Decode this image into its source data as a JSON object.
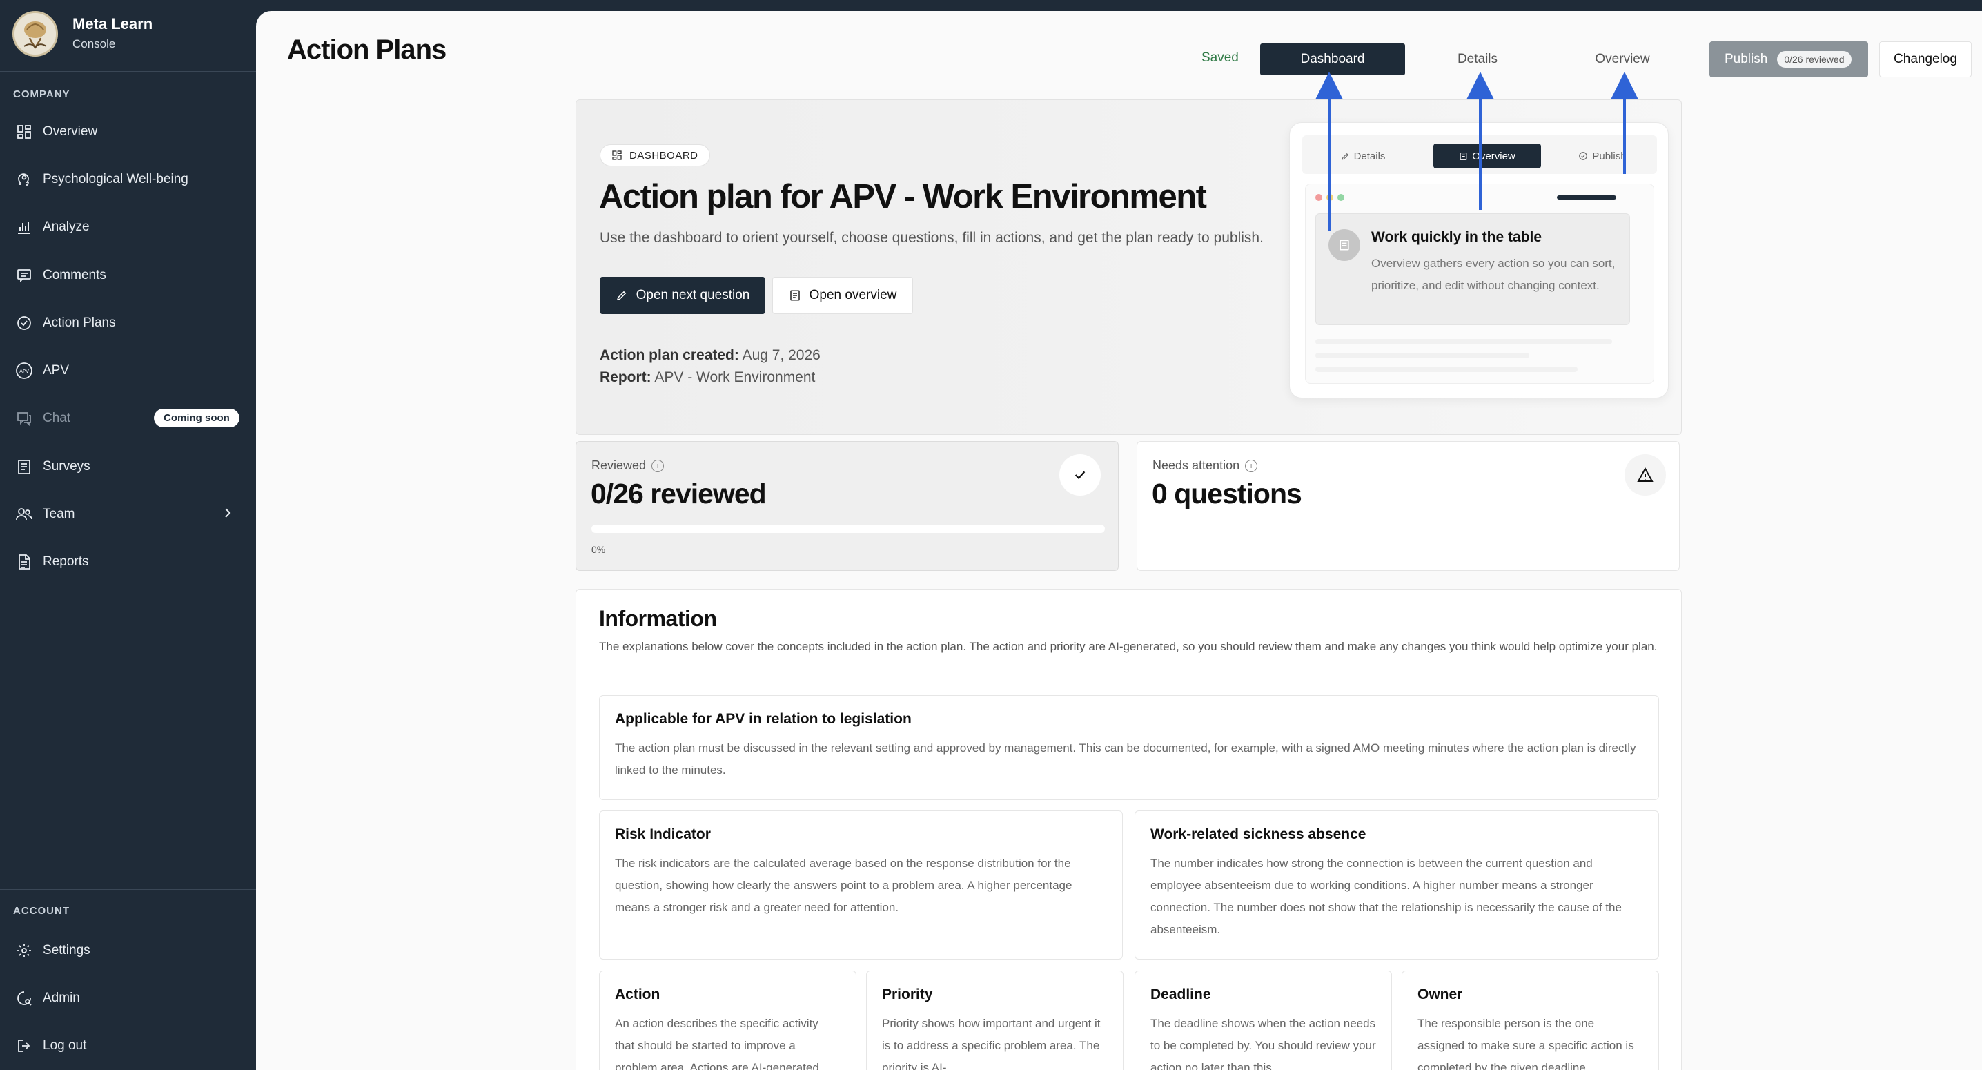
{
  "brand": {
    "name": "Meta Learn",
    "subtitle": "Console"
  },
  "sidebar": {
    "company_label": "COMPANY",
    "items": [
      {
        "label": "Overview",
        "icon": "grid-icon"
      },
      {
        "label": "Psychological Well-being",
        "icon": "head-icon"
      },
      {
        "label": "Analyze",
        "icon": "bar-chart-icon"
      },
      {
        "label": "Comments",
        "icon": "comment-icon"
      },
      {
        "label": "Action Plans",
        "icon": "check-circle-icon"
      },
      {
        "label": "APV",
        "icon": "apv-icon"
      },
      {
        "label": "Chat",
        "icon": "chat-icon",
        "badge": "Coming soon"
      },
      {
        "label": "Surveys",
        "icon": "clipboard-icon"
      },
      {
        "label": "Team",
        "icon": "users-icon"
      },
      {
        "label": "Reports",
        "icon": "document-icon"
      }
    ],
    "account_label": "ACCOUNT",
    "account_items": [
      {
        "label": "Settings",
        "icon": "gear-icon"
      },
      {
        "label": "Admin",
        "icon": "admin-icon"
      },
      {
        "label": "Log out",
        "icon": "logout-icon"
      }
    ]
  },
  "header": {
    "title": "Action Plans",
    "saved": "Saved",
    "tabs": [
      "Dashboard",
      "Details",
      "Overview"
    ],
    "active_tab": "Dashboard",
    "publish_label": "Publish",
    "publish_badge": "0/26 reviewed",
    "changelog_label": "Changelog"
  },
  "hero": {
    "chip": "DASHBOARD",
    "title": "Action plan for APV - Work Environment",
    "lead": "Use the dashboard to orient yourself, choose questions, fill in actions, and get the plan ready to publish.",
    "primary_button": "Open next question",
    "secondary_button": "Open overview",
    "created_label": "Action plan created:",
    "created_value": "Aug 7, 2026",
    "report_label": "Report:",
    "report_value": "APV - Work Environment"
  },
  "preview": {
    "tabs": [
      "Details",
      "Overview",
      "Publish"
    ],
    "active_tab": "Overview",
    "card_title": "Work quickly in the table",
    "card_text": "Overview gathers every action so you can sort, prioritize, and edit without changing context."
  },
  "stats": {
    "reviewed_label": "Reviewed",
    "reviewed_value": "0/26 reviewed",
    "reviewed_fraction": 0,
    "reviewed_pct": "0%",
    "attention_label": "Needs attention",
    "attention_value": "0 questions"
  },
  "information": {
    "title": "Information",
    "description": "The explanations below cover the concepts included in the action plan. The action and priority are AI-generated, so you should review them and make any changes you think would help optimize your plan.",
    "boxes": [
      {
        "title": "Applicable for APV in relation to legislation",
        "text": "The action plan must be discussed in the relevant setting and approved by management. This can be documented, for example, with a signed AMO meeting minutes where the action plan is directly linked to the minutes."
      },
      {
        "title": "Risk Indicator",
        "text": "The risk indicators are the calculated average based on the response distribution for the question, showing how clearly the answers point to a problem area. A higher percentage means a stronger risk and a greater need for attention."
      },
      {
        "title": "Work-related sickness absence",
        "text": "The number indicates how strong the connection is between the current question and employee absenteeism due to working conditions. A higher number means a stronger connection. The number does not show that the relationship is necessarily the cause of the absenteeism."
      },
      {
        "title": "Action",
        "text": "An action describes the specific activity that should be started to improve a problem area. Actions are AI-generated"
      },
      {
        "title": "Priority",
        "text": "Priority shows how important and urgent it is to address a specific problem area. The priority is AI-"
      },
      {
        "title": "Deadline",
        "text": "The deadline shows when the action needs to be completed by. You should review your action no later than this"
      },
      {
        "title": "Owner",
        "text": "The responsible person is the one assigned to make sure a specific action is completed by the given deadline"
      }
    ]
  },
  "colors": {
    "sidebar": "#1f2b38",
    "accent": "#1e2b38",
    "saved": "#2f7a45",
    "annotation_arrow": "#2f63d6"
  }
}
